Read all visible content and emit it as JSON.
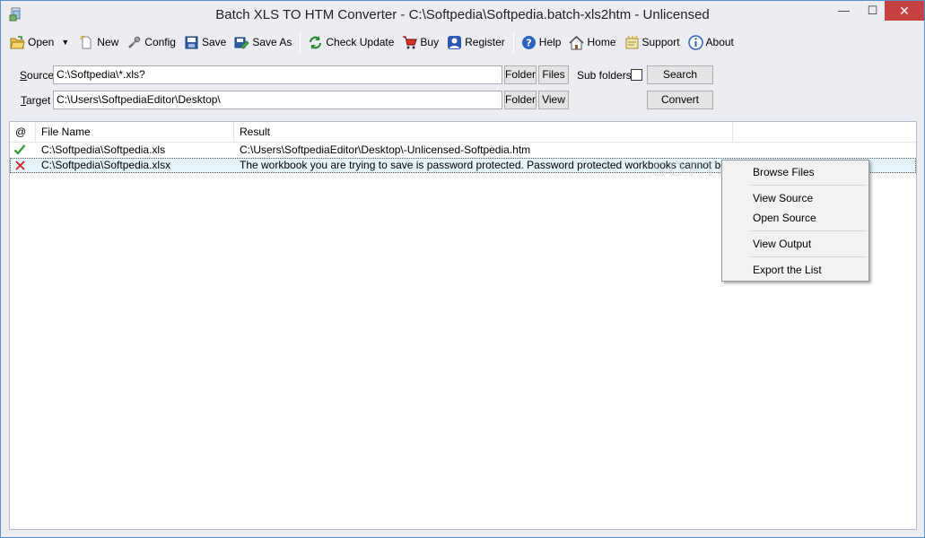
{
  "window": {
    "title": "Batch XLS TO HTM Converter - C:\\Softpedia\\Softpedia.batch-xls2htm - Unlicensed",
    "controls": {
      "minimize": "—",
      "maximize": "☐",
      "close": "✕"
    }
  },
  "toolbar": {
    "open": "Open",
    "new": "New",
    "config": "Config",
    "save": "Save",
    "save_as": "Save As",
    "check_update": "Check Update",
    "buy": "Buy",
    "register": "Register",
    "help": "Help",
    "home": "Home",
    "support": "Support",
    "about": "About"
  },
  "form": {
    "source_label_hotkey": "S",
    "source_label_rest": "ource",
    "source_value": "C:\\Softpedia\\*.xls?",
    "target_label_hotkey": "T",
    "target_label_rest": "arget",
    "target_value": "C:\\Users\\SoftpediaEditor\\Desktop\\",
    "folder_button": "Folder",
    "files_button": "Files",
    "view_button": "View",
    "subfolders_label": "Sub folders",
    "subfolders_checked": false,
    "search_button": "Search",
    "convert_button": "Convert"
  },
  "list": {
    "columns": [
      "@",
      "File Name",
      "Result"
    ],
    "rows": [
      {
        "status": "success",
        "file": "C:\\Softpedia\\Softpedia.xls",
        "result": "C:\\Users\\SoftpediaEditor\\Desktop\\-Unlicensed-Softpedia.htm"
      },
      {
        "status": "error",
        "file": "C:\\Softpedia\\Softpedia.xlsx",
        "result": "The workbook you are trying to save is password protected.  Password protected workbooks cannot be saved..."
      }
    ]
  },
  "context_menu": {
    "items": [
      "Browse Files",
      "View  Source",
      "Open Source",
      "View  Output",
      "Export the List"
    ]
  },
  "watermark": "SOFTPEDIA",
  "colors": {
    "success": "#2e9b2e",
    "error": "#d42020",
    "close_button": "#c74141"
  }
}
